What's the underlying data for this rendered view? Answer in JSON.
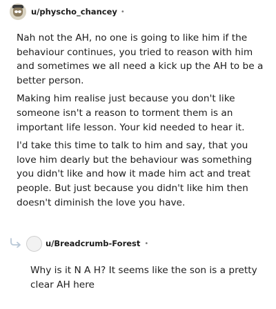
{
  "comment": {
    "username": "u/physcho_chancey",
    "separator": "•",
    "paragraphs": [
      "Nah not the AH, no one is going to like him if the behaviour continues, you tried to reason with him and sometimes we all need a kick up the AH to be a better person.",
      "Making him realise just because you don't like someone isn't a reason to torment them is an important life lesson. Your kid needed to hear it.",
      "I'd take this time to talk to him and say, that you love him dearly but the behaviour was something you didn't like and how it made him act and treat people. But just because you didn't like him then doesn't diminish the love you have."
    ]
  },
  "reply": {
    "username": "u/Breadcrumb-Forest",
    "separator": "•",
    "text": "Why is it N A H? It seems like the son is a pretty clear AH here"
  },
  "icons": {
    "comment_avatar": "user-avatar-icon",
    "reply_arrow": "reply-arrow-icon",
    "reply_avatar": "default-avatar-icon"
  }
}
